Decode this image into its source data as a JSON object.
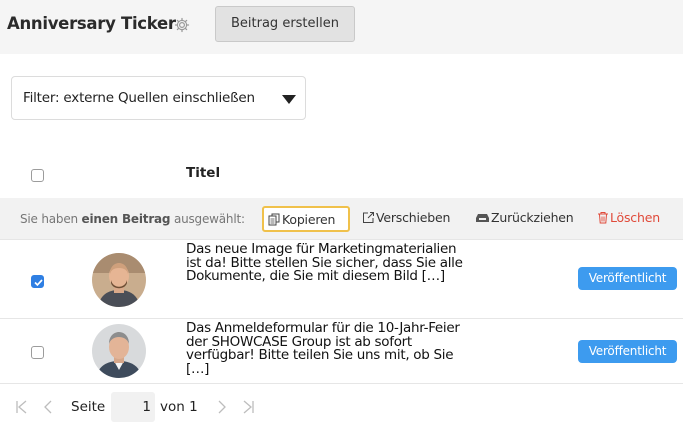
{
  "header": {
    "title": "Anniversary Ticker",
    "create_button": "Beitrag erstellen"
  },
  "filter": {
    "label": "Filter: externe Quellen einschließen"
  },
  "table": {
    "column_title": "Titel"
  },
  "selection_bar": {
    "text_before": "Sie haben ",
    "text_bold": "einen Beitrag",
    "text_after": " ausgewählt:",
    "actions": {
      "copy": "Kopieren",
      "move": "Verschieben",
      "withdraw": "Zurückziehen",
      "delete": "Löschen"
    }
  },
  "rows": [
    {
      "checked": true,
      "text": "Das neue Image für Marketingmaterialien ist da! Bitte stellen Sie sicher, dass Sie alle Dokumente, die Sie mit diesem Bild […]",
      "status": "Veröffentlicht"
    },
    {
      "checked": false,
      "text": "Das Anmeldeformular für die 10-Jahr-Feier der SHOWCASE Group ist ab sofort verfügbar! Bitte teilen Sie uns mit, ob Sie […]",
      "status": "Veröffentlicht"
    }
  ],
  "pagination": {
    "page_label": "Seite",
    "current_page": "1",
    "of_label": "von 1"
  },
  "colors": {
    "accent": "#3d9bef",
    "checkbox_checked": "#2f7fe3",
    "delete": "#e04a3a",
    "highlight": "#f0c14b"
  }
}
